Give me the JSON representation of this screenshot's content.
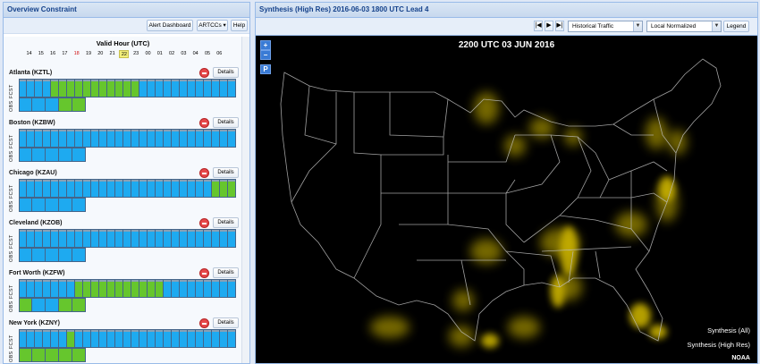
{
  "left_panel": {
    "title": "Overview Constraint",
    "buttons": {
      "alert_dashboard": "Alert Dashboard",
      "artccs": "ARTCCs ▾",
      "help": "Help"
    },
    "valid_hour_title": "Valid Hour (UTC)",
    "hours": [
      "14",
      "15",
      "16",
      "17",
      "18",
      "19",
      "20",
      "21",
      "22",
      "23",
      "00",
      "01",
      "02",
      "03",
      "04",
      "05",
      "06"
    ],
    "highlight_red_hour": "18",
    "selected_hour": "22",
    "labels": {
      "fcst": "FCST",
      "obs": "OBS",
      "details": "Details"
    },
    "centers": [
      {
        "name": "Atlanta (KZTL)",
        "fcst": "bbbbgggggggggggbbbbbbbbbbbb",
        "obs": "bbbgg"
      },
      {
        "name": "Boston (KZBW)",
        "fcst": "bbbbbbbbbbbbbbbbbbbbbbbbbbb",
        "obs": "bbbbb"
      },
      {
        "name": "Chicago (KZAU)",
        "fcst": "bbbbbbbbbbbbbbbbbbbbbbbbggg",
        "obs": "bbbbb"
      },
      {
        "name": "Cleveland (KZOB)",
        "fcst": "bbbbbbbbbbbbbbbbbbbbbbbbbbb",
        "obs": "bbbbb"
      },
      {
        "name": "Fort Worth (KZFW)",
        "fcst": "bbbbbbbgggggggggggbbbbbbbbb",
        "obs": "gbbgg"
      },
      {
        "name": "New York (KZNY)",
        "fcst": "bbbbbbgbbbbbbbbbbbbbbbbbbbb",
        "obs": "ggggg"
      }
    ]
  },
  "right_panel": {
    "title": "Synthesis (High Res) 2016-06-03 1800 UTC Lead 4",
    "nav": [
      "|◀",
      "▶",
      "▶|"
    ],
    "selects": {
      "traffic": "Historical Traffic",
      "normalization": "Local Normalized"
    },
    "legend_button": "Legend",
    "map": {
      "title": "2200 UTC 03 JUN 2016",
      "controls": {
        "zoom_in": "+",
        "zoom_out": "−",
        "pan": "P"
      },
      "layers": [
        "Synthesis (All)",
        "Synthesis (High Res)"
      ],
      "credit": "NOAA"
    }
  },
  "colors": {
    "fcst_blue": "#1eaaf0",
    "constraint_green": "#66c62d",
    "synthesis_yellow": "#b4a000",
    "header_text": "#15428b"
  }
}
